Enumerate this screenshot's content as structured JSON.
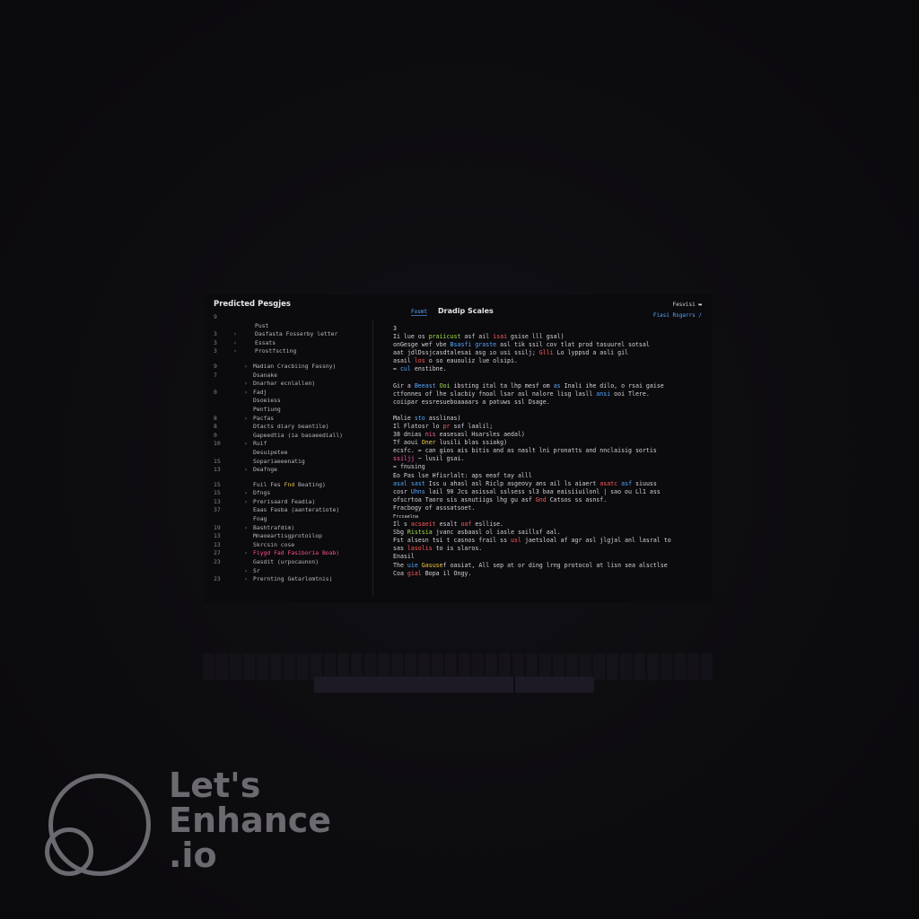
{
  "sidebar": {
    "title": "Predicted Pesgjes",
    "rows": [
      {
        "ln": "9",
        "caret": "",
        "label": "",
        "extra": ""
      },
      {
        "ln": "",
        "caret": "",
        "label": "Pust",
        "extra": ""
      },
      {
        "ln": "3",
        "caret": "›",
        "label": "Dasfasta Fosserby letter",
        "extra": ""
      },
      {
        "ln": "3",
        "caret": "‹",
        "label": "Essats",
        "extra": ""
      },
      {
        "ln": "3",
        "caret": "›",
        "label": "Prostfscting",
        "extra": ""
      },
      {
        "spacer": true
      },
      {
        "ln": "9",
        "caret": "›",
        "label": "Madian Cracbiing Fassny)",
        "extra": ""
      },
      {
        "ln": "7",
        "caret": "",
        "label": "Dsanake",
        "extra": ""
      },
      {
        "ln": "",
        "caret": "›",
        "label": "Dnarhar ecnlallen)",
        "extra": ""
      },
      {
        "ln": "0",
        "caret": "›",
        "label": "Fadj",
        "extra": ""
      },
      {
        "ln": "",
        "caret": "",
        "label": "Dsoeiess",
        "extra": ""
      },
      {
        "ln": "",
        "caret": "",
        "label": "Penfiung",
        "extra": ""
      },
      {
        "ln": "8",
        "caret": "›",
        "label": "Pacfas",
        "extra": ""
      },
      {
        "ln": "8",
        "caret": "",
        "label": "Dtacts diary beantile)",
        "extra": ""
      },
      {
        "ln": "0",
        "caret": "",
        "label": "Gapeedtia (ia basaeediall)",
        "extra": ""
      },
      {
        "ln": "10",
        "caret": "›",
        "label": "Ruif",
        "extra": ""
      },
      {
        "ln": "",
        "caret": "",
        "label": "Desuipetee",
        "extra": ""
      },
      {
        "ln": "15",
        "caret": "",
        "label": "Sopariaeeenatig",
        "extra": ""
      },
      {
        "ln": "13",
        "caret": "‹",
        "label": "Deafnge",
        "extra": ""
      },
      {
        "spacer": true
      },
      {
        "ln": "15",
        "caret": "",
        "label": "Fuil Fes ",
        "accent": "Fnd",
        "rest": " Beating)",
        "extra": ""
      },
      {
        "ln": "15",
        "caret": "›",
        "label": "Dfngs",
        "extra": ""
      },
      {
        "ln": "13",
        "caret": "›",
        "label": "Prerisaard Feadia)",
        "extra": ""
      },
      {
        "ln": "37",
        "caret": "",
        "label": "Eaas Fasba (aanteratiote)",
        "extra": ""
      },
      {
        "ln": "",
        "caret": "",
        "label": "Foag",
        "extra": ""
      },
      {
        "ln": "19",
        "caret": "›",
        "label": "Bashtrafdim)",
        "extra": ""
      },
      {
        "ln": "13",
        "caret": "",
        "label": "Mnaoeartisgprotoilop",
        "extra": ""
      },
      {
        "ln": "13",
        "caret": "",
        "label": "Skrcsin cose",
        "extra": ""
      },
      {
        "ln": "27",
        "caret": "›",
        "label": "Fiygd Fad Fasiboria Boab)",
        "hl": true,
        "extra": ""
      },
      {
        "ln": "23",
        "caret": "",
        "label": "Gasdit (urpocaunon)",
        "extra": ""
      },
      {
        "ln": "",
        "caret": "›",
        "label": "Sr",
        "extra": ""
      },
      {
        "ln": "23",
        "caret": "›",
        "label": "Prernting Getarlomtnis)",
        "extra": ""
      }
    ]
  },
  "editor": {
    "tab_file": "Fosmt",
    "tab_title": "Dradip Scales",
    "top_right_1": "Fesvisi ▬",
    "top_right_2": "Fiasi  Rsgarrs /",
    "lines": [
      [
        {
          "t": "3"
        }
      ],
      [
        {
          "t": "Ii lue os "
        },
        {
          "t": "praiicust",
          "c": "kw-green"
        },
        {
          "t": " asf ail "
        },
        {
          "t": "isai",
          "c": "kw-red"
        },
        {
          "t": " gsise lll gsal)"
        }
      ],
      [
        {
          "t": "onGesge wef vbe "
        },
        {
          "t": "Bsasfi graste",
          "c": "kw-blue"
        },
        {
          "t": " asl tik ssil cov tlat prod tasuurel sotsal"
        }
      ],
      [
        {
          "t": "aat jdlDssjcasdtalesai asg ıo usi ssilj; "
        },
        {
          "t": "Glli",
          "c": "kw-red"
        },
        {
          "t": " Lo lyppsd a asli gil"
        }
      ],
      [
        {
          "t": "asail "
        },
        {
          "t": "los",
          "c": "kw-red"
        },
        {
          "t": " o so eauouliz lue olsipi."
        }
      ],
      [
        {
          "t": "≈ "
        },
        {
          "t": "cul",
          "c": "kw-blue"
        },
        {
          "t": " enstibne."
        }
      ],
      [
        {
          "gap": true
        }
      ],
      [
        {
          "t": "Gir a "
        },
        {
          "t": "Beeast",
          "c": "kw-blue"
        },
        {
          "t": " "
        },
        {
          "t": "Ooi",
          "c": "kw-green"
        },
        {
          "t": " ibsting ital ta lhp mesf om "
        },
        {
          "t": "as",
          "c": "kw-blue"
        },
        {
          "t": " Inali ihe dilo, o rsai gaise"
        }
      ],
      [
        {
          "t": "ctfonnes of lhe slacbiy fnoal lsar asl nalore lisg lasll "
        },
        {
          "t": "ansi",
          "c": "kw-blue"
        },
        {
          "t": " ooi Tlere."
        }
      ],
      [
        {
          "t": "coiipar essresueboaaaars a patuws ssl Dsage."
        }
      ],
      [
        {
          "gap": true
        }
      ],
      [
        {
          "t": "Malie "
        },
        {
          "t": "sto",
          "c": "kw-blue"
        },
        {
          "t": " asslinas)"
        }
      ],
      [
        {
          "t": "Il Flatosr lo "
        },
        {
          "t": "pr",
          "c": "kw-red"
        },
        {
          "t": " sof laalil;"
        }
      ],
      [
        {
          "t": "38 dnias "
        },
        {
          "t": "nis",
          "c": "kw-pink"
        },
        {
          "t": " easesasl Hsarsles aedal)"
        }
      ],
      [
        {
          "t": "Tf aoui "
        },
        {
          "t": "Oner",
          "c": "kw-yellow"
        },
        {
          "t": " lusili blas ssiakg)"
        }
      ],
      [
        {
          "t": "ecsfc. ≈ can gios ais bitis and as naslt lni pronatts and nnclaisig sortis"
        }
      ],
      [
        {
          "t": "ssiljj",
          "c": "kw-pink"
        },
        {
          "t": " ~ lusil gsai."
        }
      ],
      [
        {
          "t": "≈ fnusing"
        }
      ],
      [
        {
          "t": "Eo Pas lse Hfisrlalt: aps eeaf tay alll"
        }
      ],
      [
        {
          "t": "asal",
          "c": "kw-blue"
        },
        {
          "t": " "
        },
        {
          "t": "sast",
          "c": "kw-blue"
        },
        {
          "t": " Iss u ahasl asl Riclp asgeovy ans ail ls aiaert "
        },
        {
          "t": "asatc",
          "c": "kw-red"
        },
        {
          "t": " "
        },
        {
          "t": "asf",
          "c": "kw-blue"
        },
        {
          "t": " siuuss"
        }
      ],
      [
        {
          "t": "cosr "
        },
        {
          "t": "Uhns",
          "c": "kw-blue"
        },
        {
          "t": " lail 90 Jcs asissal sslsess sl3 baa eaisiiuilonl | sao ou Ll1 ass"
        }
      ],
      [
        {
          "t": "ofscrtoa Taoro sis asnutiigs lhg gu asf "
        },
        {
          "t": "Gnd",
          "c": "kw-red"
        },
        {
          "t": " Catsos ss asnsf."
        }
      ],
      [
        {
          "t": "Fracbogy of asssatsoet."
        }
      ],
      [
        {
          "t": "Frcsaelna",
          "small": true
        }
      ],
      [
        {
          "t": "Il s "
        },
        {
          "t": "acsaeit",
          "c": "kw-red"
        },
        {
          "t": " esalt "
        },
        {
          "t": "oaf",
          "c": "kw-red"
        },
        {
          "t": " esllise."
        }
      ],
      [
        {
          "t": "Sbg "
        },
        {
          "t": "Ristsia",
          "c": "kw-green"
        },
        {
          "t": " jvanc asbaasl ol iasle saillsf aal."
        }
      ],
      [
        {
          "t": "Fst alsesn tsi t casnos frail ss "
        },
        {
          "t": "usl",
          "c": "kw-red"
        },
        {
          "t": " jaetsloal af agr asl jlgjal anl lasral to"
        }
      ],
      [
        {
          "t": "sas "
        },
        {
          "t": "lasolis",
          "c": "kw-red"
        },
        {
          "t": " to is slaros."
        }
      ],
      [
        {
          "t": "Enasil"
        }
      ],
      [
        {
          "t": "The "
        },
        {
          "t": "uie",
          "c": "kw-blue"
        },
        {
          "t": " "
        },
        {
          "t": "Gasuse",
          "c": "kw-yellow"
        },
        {
          "t": "f oasiat, All sep at or ding lrng protocol at lisn sea alsctlse"
        }
      ],
      [
        {
          "t": "Coa "
        },
        {
          "t": "gial",
          "c": "kw-red"
        },
        {
          "t": " Bopa il Ongy."
        }
      ]
    ]
  },
  "watermark": {
    "line1": "Let's",
    "line2": "Enhance",
    "line3": ".io"
  },
  "colors": {
    "background": "#0d0c0f",
    "accent_blue": "#54a8ff",
    "accent_green": "#9fe04a",
    "accent_red": "#ff5a5a",
    "accent_pink": "#ff5ca8",
    "accent_yellow": "#f2cf45",
    "watermark": "#6c6a70"
  }
}
